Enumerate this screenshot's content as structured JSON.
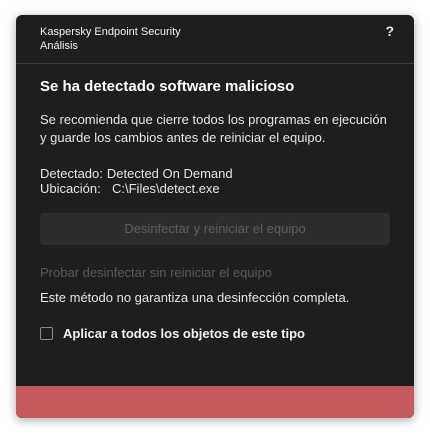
{
  "header": {
    "app_name": "Kaspersky Endpoint Security",
    "subtitle": "Análisis",
    "help_glyph": "?"
  },
  "dialog": {
    "title": "Se ha detectado software malicioso",
    "recommendation": "Se recomienda que cierre todos los programas en ejecución y guarde los cambios antes de reiniciar el equipo.",
    "detected_label": "Detectado:",
    "detected_value": "Detected On Demand",
    "location_label": "Ubicación:",
    "location_value": "C:\\Files\\detect.exe",
    "primary_button": "Desinfectar y reiniciar el equipo",
    "secondary_link": "Probar desinfectar sin reiniciar el equipo",
    "warning": "Este método no garantiza una desinfección completa.",
    "checkbox_label": "Aplicar a todos los objetos de este tipo",
    "checkbox_checked": false
  },
  "colors": {
    "dialog_bg": "#1e1e1e",
    "footer_accent": "#c45a5e",
    "disabled_text": "#5a5a5a"
  }
}
